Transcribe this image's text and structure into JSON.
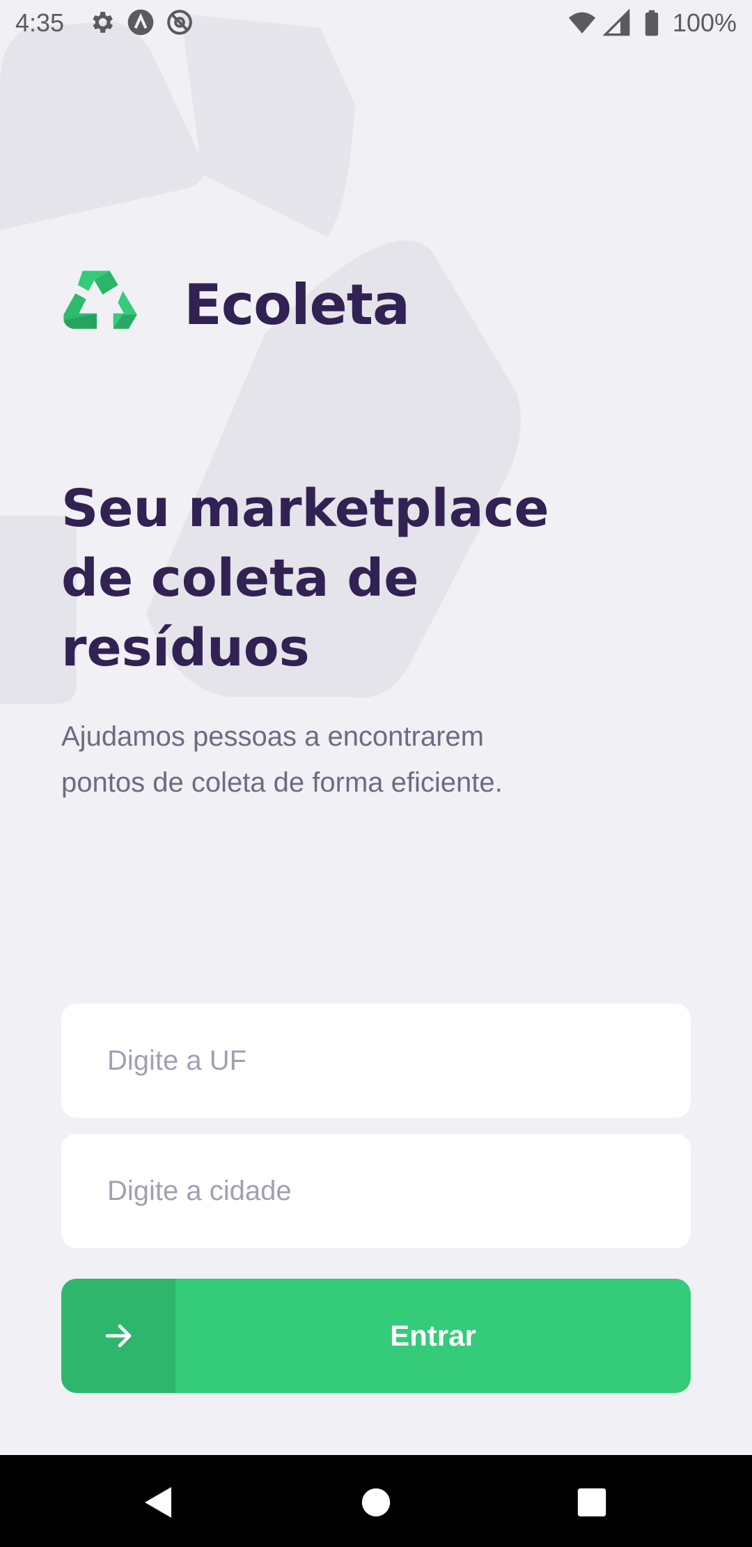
{
  "status_bar": {
    "time": "4:35",
    "battery": "100%",
    "icons_left": [
      "settings-icon",
      "alert-a-icon",
      "at-sign-icon"
    ],
    "icons_right": [
      "wifi-icon",
      "signal-icon",
      "battery-icon"
    ]
  },
  "brand": {
    "name": "Ecoleta",
    "logo_icon": "recycle-icon",
    "primary_color": "#34CB79",
    "title_color": "#322153",
    "text_color": "#6C6C80",
    "background": "#F0F0F5"
  },
  "hero": {
    "title_line1": "Seu marketplace",
    "title_line2": "de coleta de",
    "title_line3": "resíduos",
    "description_line1": "Ajudamos pessoas a encontrarem",
    "description_line2": "pontos de coleta de forma eficiente."
  },
  "form": {
    "uf_placeholder": "Digite a UF",
    "uf_value": "",
    "city_placeholder": "Digite a cidade",
    "city_value": "",
    "submit_label": "Entrar",
    "submit_icon": "arrow-right-icon"
  },
  "nav_bar": {
    "buttons": [
      "back-icon",
      "home-icon",
      "recents-icon"
    ]
  }
}
